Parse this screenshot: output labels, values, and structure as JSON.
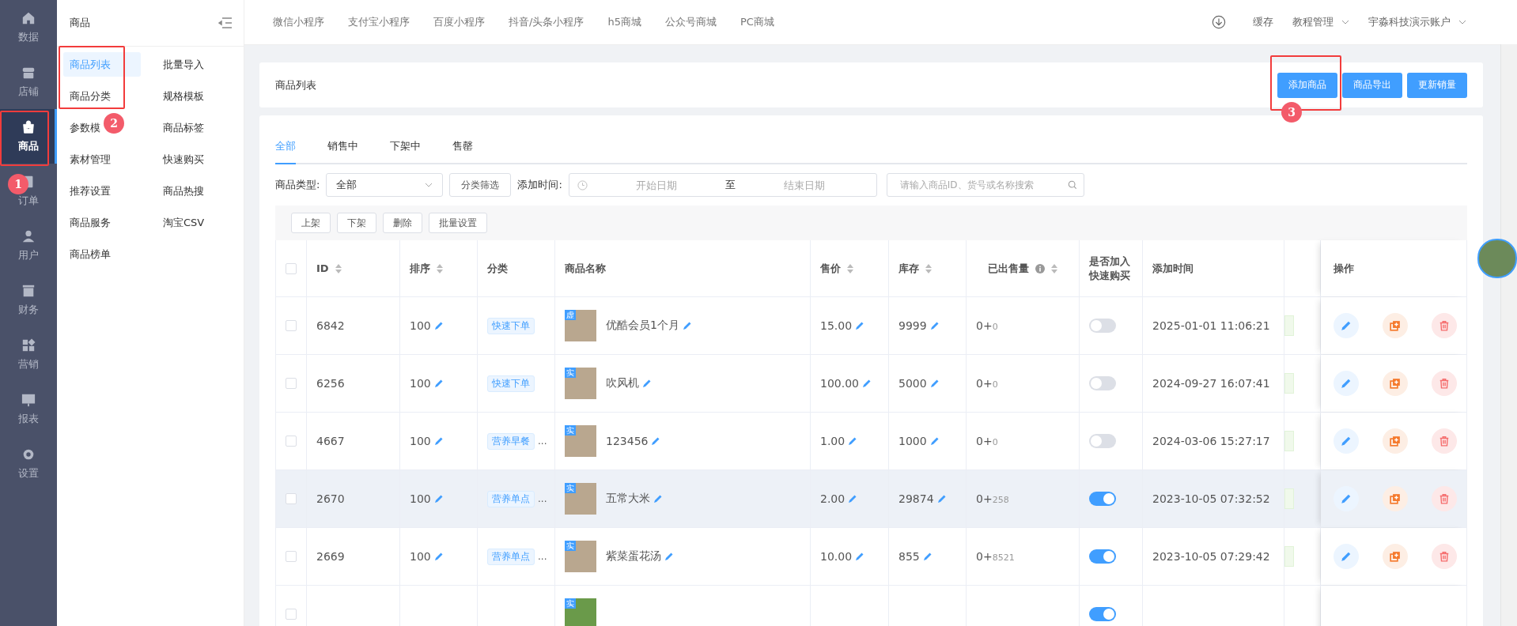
{
  "nav_rail": {
    "items": [
      {
        "label": "数据",
        "kind": "home",
        "selected": false
      },
      {
        "label": "店铺",
        "kind": "store",
        "selected": false
      },
      {
        "label": "商品",
        "kind": "bag",
        "selected": true
      },
      {
        "label": "订单",
        "kind": "doc",
        "selected": false
      },
      {
        "label": "用户",
        "kind": "user",
        "selected": false
      },
      {
        "label": "财务",
        "kind": "wallet",
        "selected": false
      },
      {
        "label": "营销",
        "kind": "grid",
        "selected": false
      },
      {
        "label": "报表",
        "kind": "chart",
        "selected": false
      },
      {
        "label": "设置",
        "kind": "gear",
        "selected": false
      }
    ]
  },
  "submenu": {
    "title": "商品",
    "items": [
      {
        "label": "商品列表",
        "selected": true
      },
      {
        "label": "批量导入",
        "selected": false
      },
      {
        "label": "商品分类",
        "selected": false
      },
      {
        "label": "规格模板",
        "selected": false
      },
      {
        "label": "参数模",
        "selected": false
      },
      {
        "label": "商品标签",
        "selected": false
      },
      {
        "label": "素材管理",
        "selected": false
      },
      {
        "label": "快速购买",
        "selected": false
      },
      {
        "label": "推荐设置",
        "selected": false
      },
      {
        "label": "商品热搜",
        "selected": false
      },
      {
        "label": "商品服务",
        "selected": false
      },
      {
        "label": "淘宝CSV",
        "selected": false
      },
      {
        "label": "商品榜单",
        "selected": false
      }
    ]
  },
  "top_bar": {
    "tabs": [
      "微信小程序",
      "支付宝小程序",
      "百度小程序",
      "抖音/头条小程序",
      "h5商城",
      "公众号商城",
      "PC商城"
    ],
    "cache": "缓存",
    "tutorial": "教程管理",
    "account": "宇淼科技演示账户"
  },
  "page_header": {
    "title": "商品列表",
    "buttons": [
      "添加商品",
      "商品导出",
      "更新销量"
    ]
  },
  "status_tabs": [
    {
      "label": "全部",
      "selected": true
    },
    {
      "label": "销售中",
      "selected": false
    },
    {
      "label": "下架中",
      "selected": false
    },
    {
      "label": "售罄",
      "selected": false
    }
  ],
  "filters": {
    "type_label": "商品类型:",
    "type_value": "全部",
    "category_button": "分类筛选",
    "time_label": "添加时间:",
    "start_placeholder": "开始日期",
    "range_separator": "至",
    "end_placeholder": "结束日期",
    "search_placeholder": "请输入商品ID、货号或名称搜索"
  },
  "bulk_actions": [
    "上架",
    "下架",
    "删除",
    "批量设置"
  ],
  "table": {
    "select_all_checked": false,
    "columns": [
      {
        "label": "ID",
        "sortable": true
      },
      {
        "label": "排序",
        "sortable": true
      },
      {
        "label": "分类",
        "sortable": false
      },
      {
        "label": "商品名称",
        "sortable": false
      },
      {
        "label": "售价",
        "sortable": true
      },
      {
        "label": "库存",
        "sortable": true
      },
      {
        "label": "已出售量",
        "sortable": true
      },
      {
        "label": "是否加入快速购买",
        "sortable": false
      },
      {
        "label": "添加时间",
        "sortable": false
      },
      {
        "label": "操作",
        "sortable": false
      }
    ],
    "rows": [
      {
        "checked": false,
        "id": "6842",
        "sort": "100",
        "tag": "快速下单",
        "badge": "虚",
        "name": "优酷会员1个月",
        "price": "15.00",
        "stock": "9999",
        "sold": "0+",
        "sold_extra": "0",
        "quick_buy": false,
        "time": "2025-01-01 11:06:21",
        "highlighted": false
      },
      {
        "checked": false,
        "id": "6256",
        "sort": "100",
        "tag": "快速下单",
        "badge": "实",
        "name": "吹风机",
        "price": "100.00",
        "stock": "5000",
        "sold": "0+",
        "sold_extra": "0",
        "quick_buy": false,
        "time": "2024-09-27 16:07:41",
        "highlighted": false
      },
      {
        "checked": false,
        "id": "4667",
        "sort": "100",
        "tag": "营养早餐",
        "tag_more": "...",
        "badge": "实",
        "name": "123456",
        "price": "1.00",
        "stock": "1000",
        "sold": "0+",
        "sold_extra": "0",
        "quick_buy": false,
        "time": "2024-03-06 15:27:17",
        "highlighted": false
      },
      {
        "checked": false,
        "id": "2670",
        "sort": "100",
        "tag": "营养单点",
        "tag_more": "...",
        "badge": "实",
        "name": "五常大米",
        "price": "2.00",
        "stock": "29874",
        "sold": "0+",
        "sold_extra": "258",
        "quick_buy": true,
        "time": "2023-10-05 07:32:52",
        "highlighted": true
      },
      {
        "checked": false,
        "id": "2669",
        "sort": "100",
        "tag": "营养单点",
        "tag_more": "...",
        "badge": "实",
        "name": "紫菜蛋花汤",
        "price": "10.00",
        "stock": "855",
        "sold": "0+",
        "sold_extra": "8521",
        "quick_buy": true,
        "time": "2023-10-05 07:29:42",
        "highlighted": false
      }
    ],
    "partial_row": {
      "badge": "实",
      "quick_buy": true,
      "checked": false
    }
  },
  "annotations": [
    "1",
    "2",
    "3"
  ]
}
